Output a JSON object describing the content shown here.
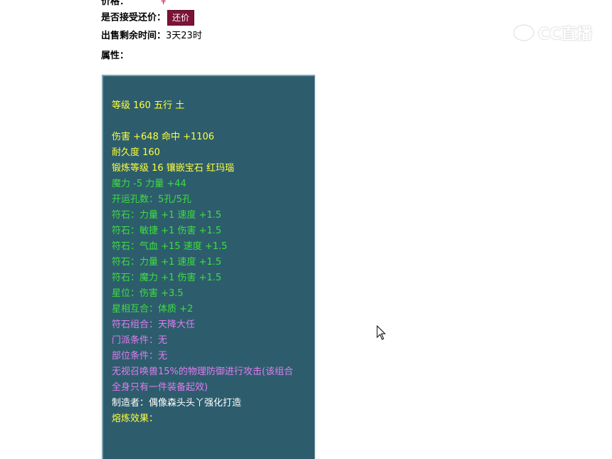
{
  "price_row": {
    "label": "价格：",
    "value": "¥"
  },
  "bargain": {
    "label": "是否接受还价：",
    "button": "还价"
  },
  "time_left": {
    "label": "出售剩余时间：",
    "value": "3天23时"
  },
  "attributes": {
    "label": "属性："
  },
  "item": {
    "lines": [
      {
        "text": "等级 160 五行 土",
        "color": "yellow"
      },
      {
        "text": "",
        "color": "gap"
      },
      {
        "text": "伤害 +648 命中 +1106",
        "color": "yellow"
      },
      {
        "text": "耐久度 160",
        "color": "yellow"
      },
      {
        "text": "锻炼等级 16 镶嵌宝石 红玛瑙",
        "color": "yellow"
      },
      {
        "text": "魔力 -5 力量 +44",
        "color": "green"
      },
      {
        "text": "开运孔数：5孔/5孔",
        "color": "green"
      },
      {
        "text": "符石：力量 +1 速度 +1.5",
        "color": "green"
      },
      {
        "text": "符石：敏捷 +1 伤害 +1.5",
        "color": "green"
      },
      {
        "text": "符石：气血 +15 速度 +1.5",
        "color": "green"
      },
      {
        "text": "符石：力量 +1 速度 +1.5",
        "color": "green"
      },
      {
        "text": "符石：魔力 +1 伤害 +1.5",
        "color": "green"
      },
      {
        "text": "星位：伤害 +3.5",
        "color": "green"
      },
      {
        "text": "星相互合：体质 +2",
        "color": "green"
      },
      {
        "text": "符石组合：天降大任",
        "color": "violet"
      },
      {
        "text": "门派条件：无",
        "color": "violet"
      },
      {
        "text": "部位条件：无",
        "color": "violet"
      },
      {
        "text": "无视召唤兽15%的物理防御进行攻击(该组合",
        "color": "violet"
      },
      {
        "text": "全身只有一件装备起效)",
        "color": "violet"
      },
      {
        "text": "制造者：偶像森头头丫强化打造",
        "color": "white"
      },
      {
        "text": "熔炼效果：",
        "color": "yellow"
      }
    ]
  },
  "watermark": {
    "text": "CC直播",
    "icon": "cc-eye-logo"
  },
  "colors": {
    "panel_bg": "#2d5d6d",
    "button_bg": "#7d1238",
    "yellow": "#ffff3a",
    "green": "#3ddf3d",
    "violet": "#e07cf0"
  }
}
